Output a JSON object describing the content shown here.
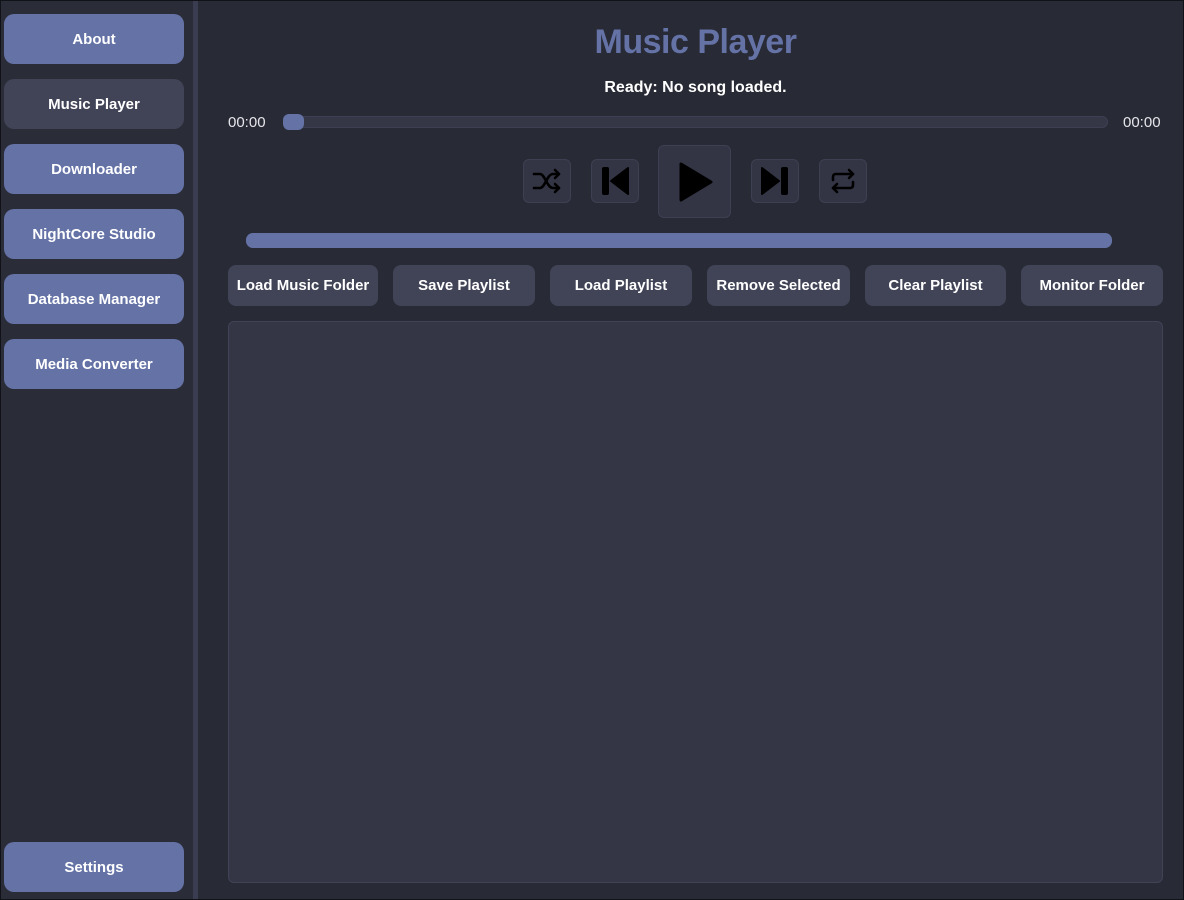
{
  "sidebar": {
    "items": [
      {
        "label": "About",
        "active": false
      },
      {
        "label": "Music Player",
        "active": true
      },
      {
        "label": "Downloader",
        "active": false
      },
      {
        "label": "NightCore Studio",
        "active": false
      },
      {
        "label": "Database Manager",
        "active": false
      },
      {
        "label": "Media Converter",
        "active": false
      }
    ],
    "settings_label": "Settings"
  },
  "player": {
    "title": "Music Player",
    "status": "Ready: No song loaded.",
    "time_elapsed": "00:00",
    "time_total": "00:00",
    "progress": 0,
    "volume": 1.0,
    "controls": {
      "shuffle": "shuffle-icon",
      "previous": "skip-previous-icon",
      "play": "play-icon",
      "next": "skip-next-icon",
      "repeat": "repeat-icon"
    }
  },
  "actions": [
    {
      "label": "Load Music Folder"
    },
    {
      "label": "Save Playlist"
    },
    {
      "label": "Load Playlist"
    },
    {
      "label": "Remove Selected"
    },
    {
      "label": "Clear Playlist"
    },
    {
      "label": "Monitor Folder"
    }
  ],
  "playlist": {
    "items": []
  },
  "colors": {
    "accent": "#6472a6",
    "background": "#282a36",
    "button": "#414457",
    "panel": "#343646"
  }
}
